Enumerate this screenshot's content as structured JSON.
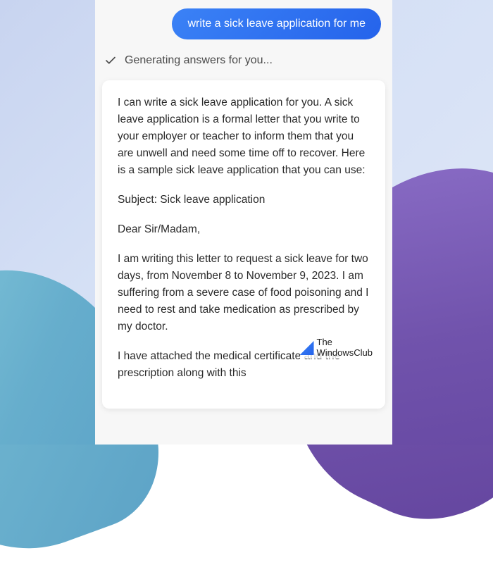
{
  "user_message": "write a sick leave application for me",
  "status": {
    "text": "Generating answers for you..."
  },
  "response": {
    "p1": "I can write a sick leave application for you. A sick leave application is a formal letter that you write to your employer or teacher to inform them that you are unwell and need some time off to recover. Here is a sample sick leave application that you can use:",
    "p2": "Subject: Sick leave application",
    "p3": "Dear Sir/Madam,",
    "p4": "I am writing this letter to request a sick leave for two days, from November 8 to November 9, 2023. I am suffering from a severe case of food poisoning and I need to rest and take medication as prescribed by my doctor.",
    "p5": "I have attached the medical certificate and the prescription along with this"
  },
  "watermark": {
    "line1": "The",
    "line2": "WindowsClub"
  }
}
